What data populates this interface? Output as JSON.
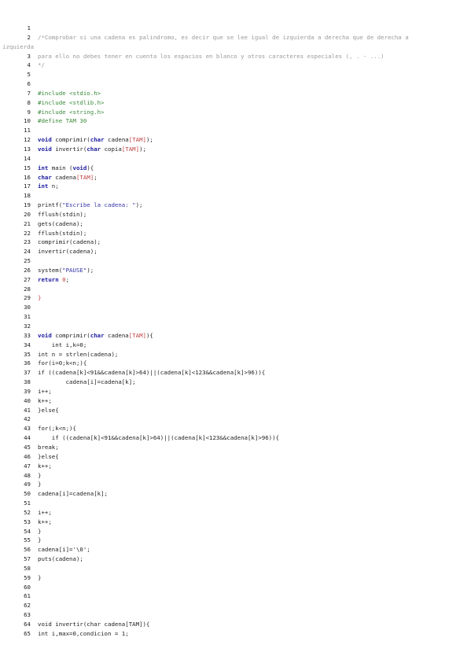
{
  "document": {
    "type": "source-code-listing",
    "lines": [
      {
        "no": "1",
        "segs": []
      },
      {
        "no": "2",
        "segs": [
          [
            "c",
            "/*Comprobar si una cadena es palindromo, es decir que se lee igual de izquierda a derecha que de derecha a"
          ]
        ],
        "wrap": "izquierda"
      },
      {
        "no": "3",
        "segs": [
          [
            "c",
            "para ello no debes tener en cuenta los espacios en blanco y otros caracteres especiales (, . - ...)"
          ]
        ]
      },
      {
        "no": "4",
        "segs": [
          [
            "c",
            "*/"
          ]
        ]
      },
      {
        "no": "5",
        "segs": []
      },
      {
        "no": "6",
        "segs": []
      },
      {
        "no": "7",
        "segs": [
          [
            "p",
            "#include <stdio.h>"
          ]
        ]
      },
      {
        "no": "8",
        "segs": [
          [
            "p",
            "#include <stdlib.h>"
          ]
        ]
      },
      {
        "no": "9",
        "segs": [
          [
            "p",
            "#include <string.h>"
          ]
        ]
      },
      {
        "no": "10",
        "segs": [
          [
            "p",
            "#define TAM 30"
          ]
        ]
      },
      {
        "no": "11",
        "segs": []
      },
      {
        "no": "12",
        "segs": [
          [
            "k",
            "void"
          ],
          [
            "f",
            " comprimir("
          ],
          [
            "t",
            "char"
          ],
          [
            "f",
            " cadena"
          ],
          [
            "b",
            "[TAM]"
          ],
          [
            "f",
            ");"
          ]
        ]
      },
      {
        "no": "13",
        "segs": [
          [
            "k",
            "void"
          ],
          [
            "f",
            " invertir("
          ],
          [
            "t",
            "char"
          ],
          [
            "f",
            " copia"
          ],
          [
            "b",
            "[TAM]"
          ],
          [
            "f",
            ");"
          ]
        ]
      },
      {
        "no": "14",
        "segs": []
      },
      {
        "no": "15",
        "segs": [
          [
            "k",
            "int"
          ],
          [
            "f",
            " main ("
          ],
          [
            "k",
            "void"
          ],
          [
            "f",
            "){"
          ]
        ]
      },
      {
        "no": "16",
        "segs": [
          [
            "t",
            "char"
          ],
          [
            "f",
            " cadena"
          ],
          [
            "b",
            "[TAM]"
          ],
          [
            "f",
            ";"
          ]
        ]
      },
      {
        "no": "17",
        "segs": [
          [
            "k",
            "int"
          ],
          [
            "f",
            " n;"
          ]
        ]
      },
      {
        "no": "18",
        "segs": []
      },
      {
        "no": "19",
        "segs": [
          [
            "f",
            "printf("
          ],
          [
            "s",
            "\"Escribe la cadena: \""
          ],
          [
            "f",
            ");"
          ]
        ]
      },
      {
        "no": "20",
        "segs": [
          [
            "f",
            "fflush(stdin);"
          ]
        ]
      },
      {
        "no": "21",
        "segs": [
          [
            "f",
            "gets(cadena);"
          ]
        ]
      },
      {
        "no": "22",
        "segs": [
          [
            "f",
            "fflush(stdin);"
          ]
        ]
      },
      {
        "no": "23",
        "segs": [
          [
            "f",
            "comprimir(cadena);"
          ]
        ]
      },
      {
        "no": "24",
        "segs": [
          [
            "f",
            "invertir(cadena);"
          ]
        ]
      },
      {
        "no": "25",
        "segs": []
      },
      {
        "no": "26",
        "segs": [
          [
            "f",
            "system("
          ],
          [
            "s",
            "\"PAUSE\""
          ],
          [
            "f",
            ");"
          ]
        ]
      },
      {
        "no": "27",
        "segs": [
          [
            "k",
            "return"
          ],
          [
            "f",
            " "
          ],
          [
            "n",
            "0"
          ],
          [
            "f",
            ";"
          ]
        ]
      },
      {
        "no": "28",
        "segs": []
      },
      {
        "no": "29",
        "segs": [
          [
            "b",
            "}"
          ]
        ]
      },
      {
        "no": "30",
        "segs": []
      },
      {
        "no": "31",
        "segs": []
      },
      {
        "no": "32",
        "segs": []
      },
      {
        "no": "33",
        "segs": [
          [
            "k",
            "void"
          ],
          [
            "f",
            " comprimir("
          ],
          [
            "t",
            "char"
          ],
          [
            "f",
            " cadena"
          ],
          [
            "b",
            "[TAM]"
          ],
          [
            "f",
            "){"
          ]
        ]
      },
      {
        "no": "34",
        "segs": [
          [
            "f",
            "    int i,k=0;"
          ]
        ]
      },
      {
        "no": "35",
        "segs": [
          [
            "f",
            "int n = strlen(cadena);"
          ]
        ]
      },
      {
        "no": "36",
        "segs": [
          [
            "f",
            "for(i=0;k<n;){"
          ]
        ]
      },
      {
        "no": "37",
        "segs": [
          [
            "f",
            "if ((cadena[k]<91&&cadena[k]>64)||(cadena[k]<123&&cadena[k]>96)){"
          ]
        ]
      },
      {
        "no": "38",
        "segs": [
          [
            "f",
            "        cadena[i]=cadena[k];"
          ]
        ]
      },
      {
        "no": "39",
        "segs": [
          [
            "f",
            "i++;"
          ]
        ]
      },
      {
        "no": "40",
        "segs": [
          [
            "f",
            "k++;"
          ]
        ]
      },
      {
        "no": "41",
        "segs": [
          [
            "f",
            "}else{"
          ]
        ]
      },
      {
        "no": "42",
        "segs": []
      },
      {
        "no": "43",
        "segs": [
          [
            "f",
            "for(;k<n;){"
          ]
        ]
      },
      {
        "no": "44",
        "segs": [
          [
            "f",
            "    if ((cadena[k]<91&&cadena[k]>64)||(cadena[k]<123&&cadena[k]>96)){"
          ]
        ]
      },
      {
        "no": "45",
        "segs": [
          [
            "f",
            "break;"
          ]
        ]
      },
      {
        "no": "46",
        "segs": [
          [
            "f",
            "}else{"
          ]
        ]
      },
      {
        "no": "47",
        "segs": [
          [
            "f",
            "k++;"
          ]
        ]
      },
      {
        "no": "48",
        "segs": [
          [
            "f",
            "}"
          ]
        ]
      },
      {
        "no": "49",
        "segs": [
          [
            "f",
            "}"
          ]
        ]
      },
      {
        "no": "50",
        "segs": [
          [
            "f",
            "cadena[i]=cadena[k];"
          ]
        ]
      },
      {
        "no": "51",
        "segs": []
      },
      {
        "no": "52",
        "segs": [
          [
            "f",
            "i++;"
          ]
        ]
      },
      {
        "no": "53",
        "segs": [
          [
            "f",
            "k++;"
          ]
        ]
      },
      {
        "no": "54",
        "segs": [
          [
            "f",
            "}"
          ]
        ]
      },
      {
        "no": "55",
        "segs": [
          [
            "f",
            "}"
          ]
        ]
      },
      {
        "no": "56",
        "segs": [
          [
            "f",
            "cadena[i]='\\0';"
          ]
        ]
      },
      {
        "no": "57",
        "segs": [
          [
            "f",
            "puts(cadena);"
          ]
        ]
      },
      {
        "no": "58",
        "segs": []
      },
      {
        "no": "59",
        "segs": [
          [
            "f",
            "}"
          ]
        ]
      },
      {
        "no": "60",
        "segs": []
      },
      {
        "no": "61",
        "segs": []
      },
      {
        "no": "62",
        "segs": []
      },
      {
        "no": "63",
        "segs": []
      },
      {
        "no": "64",
        "segs": [
          [
            "f",
            "void invertir(char cadena[TAM]){"
          ]
        ]
      },
      {
        "no": "65",
        "segs": [
          [
            "f",
            "int i,max=0,condicion = 1;"
          ]
        ]
      }
    ]
  }
}
